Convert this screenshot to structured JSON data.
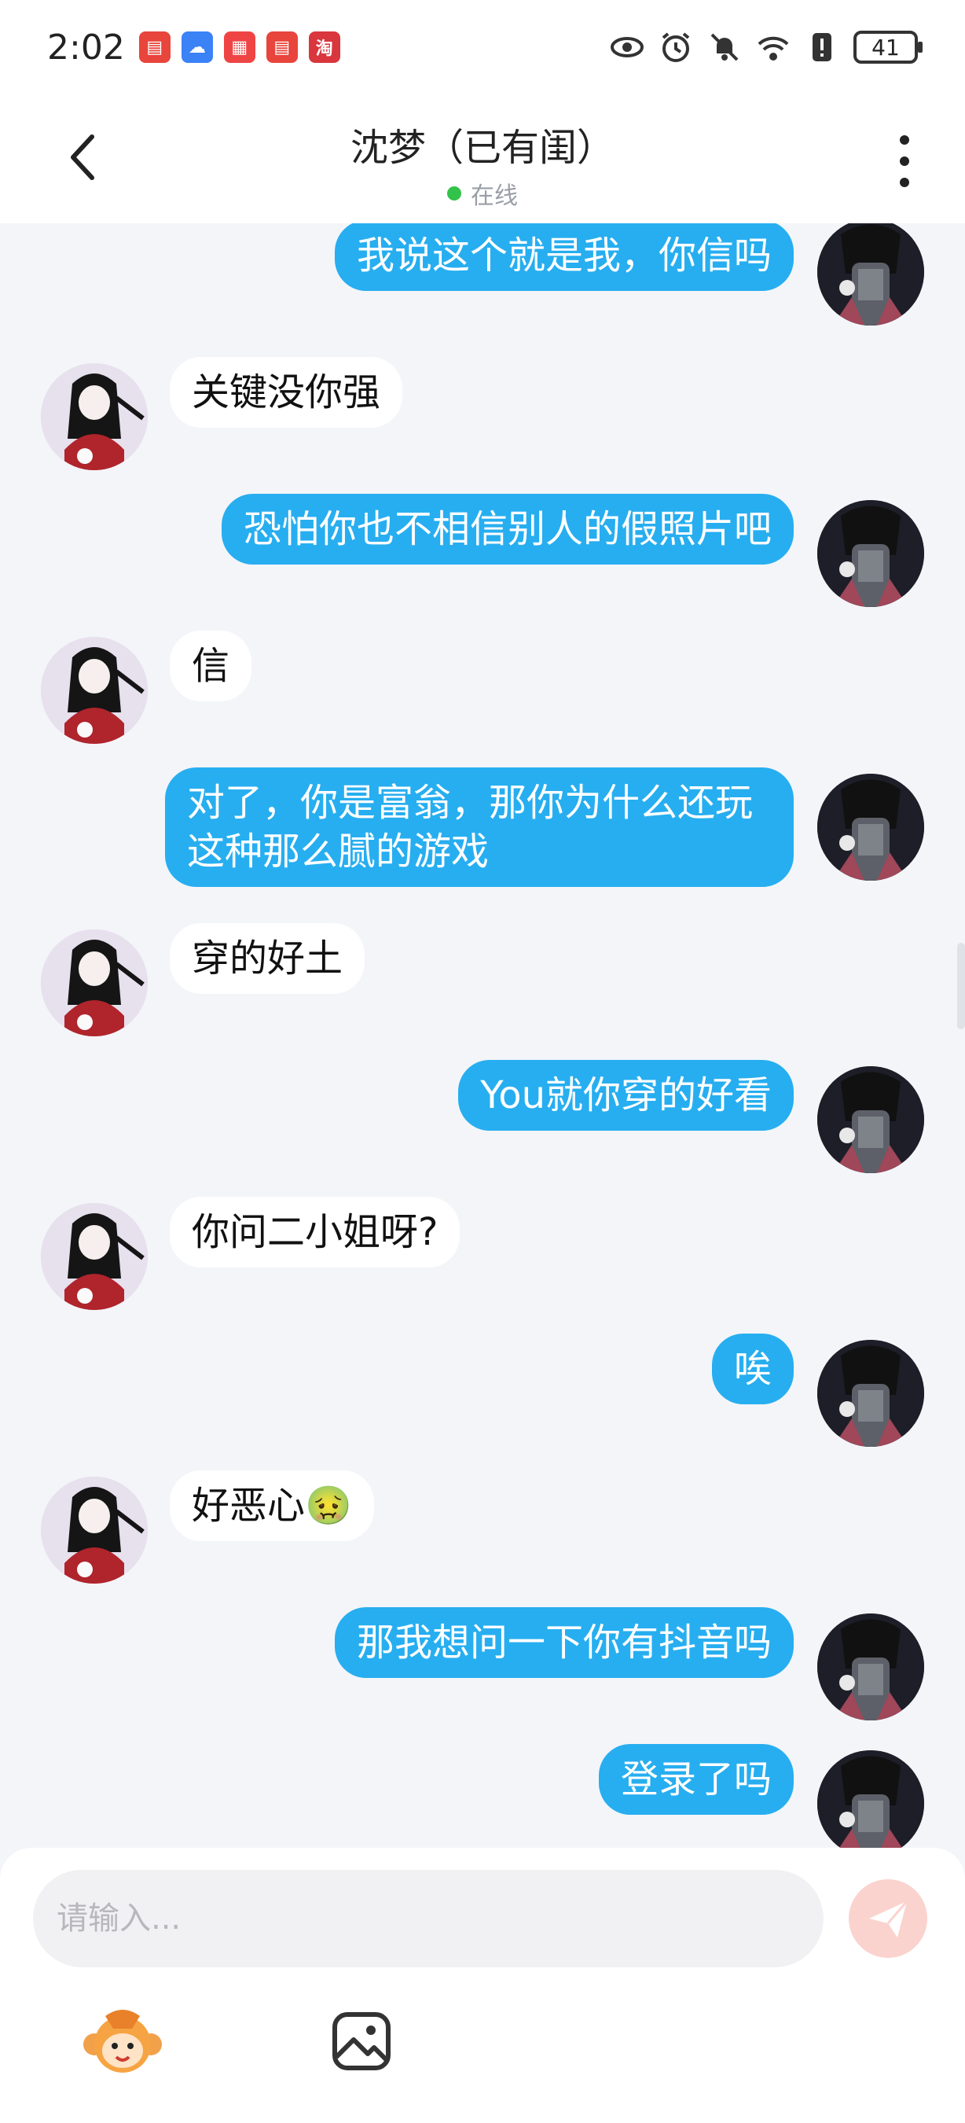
{
  "status_bar": {
    "time": "2:02",
    "battery": "41",
    "apps": [
      {
        "name": "huawei-app-icon",
        "color": "#e8453c",
        "glyph": "▤"
      },
      {
        "name": "cloud-app-icon",
        "color": "#3b82f6",
        "glyph": "☁"
      },
      {
        "name": "gift-app-icon",
        "color": "#ef4444",
        "glyph": "▦"
      },
      {
        "name": "huawei-store-icon",
        "color": "#e8453c",
        "glyph": "▤"
      },
      {
        "name": "taobao-app-icon",
        "color": "#d9363e",
        "glyph": "淘"
      }
    ]
  },
  "header": {
    "title": "沈梦（已有闺）",
    "status": "在线"
  },
  "messages": [
    {
      "side": "right",
      "text": "我说这个就是我，你信吗"
    },
    {
      "side": "left",
      "text": "关键没你强"
    },
    {
      "side": "right",
      "text": "恐怕你也不相信别人的假照片吧"
    },
    {
      "side": "left",
      "text": "信"
    },
    {
      "side": "right",
      "text": "对了，你是富翁，那你为什么还玩这种那么腻的游戏"
    },
    {
      "side": "left",
      "text": "穿的好土"
    },
    {
      "side": "right",
      "text": "You就你穿的好看"
    },
    {
      "side": "left",
      "text": "你问二小姐呀?"
    },
    {
      "side": "right",
      "text": "唉"
    },
    {
      "side": "left",
      "text": "好恶心🤢"
    },
    {
      "side": "right",
      "text": "那我想问一下你有抖音吗"
    },
    {
      "side": "right",
      "text": "登录了吗"
    }
  ],
  "input": {
    "placeholder": "请输入...",
    "value": ""
  },
  "colors": {
    "bubble_self": "#27aef0",
    "bubble_other": "#ffffff",
    "background": "#f3f5f9",
    "online": "#33c24a",
    "send_disabled": "#fbd3ce"
  }
}
